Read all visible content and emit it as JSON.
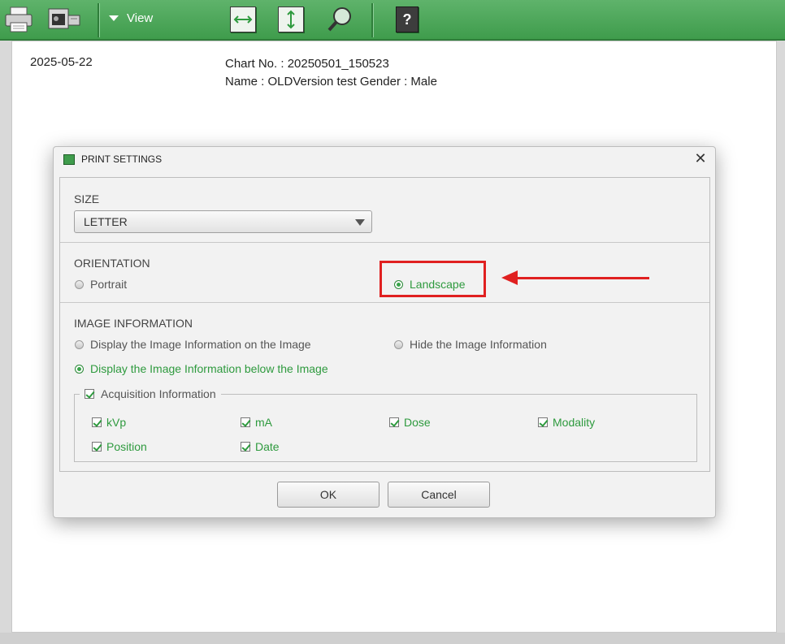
{
  "toolbar": {
    "view_label": "View",
    "icons": [
      "printer-icon",
      "scanner-icon",
      "fit-width-icon",
      "fit-height-icon",
      "zoom-icon",
      "help-icon"
    ],
    "help_glyph": "?",
    "accent": "#3f9c4c"
  },
  "page": {
    "date": "2025-05-22",
    "chart_no": "Chart No. : 20250501_150523",
    "name_line": "Name : OLDVersion test Gender : Male"
  },
  "dialog": {
    "title": "PRINT SETTINGS",
    "close_glyph": "✕",
    "size": {
      "label": "SIZE",
      "selected": "LETTER"
    },
    "orientation": {
      "label": "ORIENTATION",
      "portrait": "Portrait",
      "landscape": "Landscape",
      "selected": "Landscape"
    },
    "image_info": {
      "label": "IMAGE INFORMATION",
      "on_image": "Display the Image Information on the Image",
      "hide": "Hide the Image Information",
      "below_image": "Display the Image Information below the Image",
      "selected": "Display the Image Information below the Image"
    },
    "acquisition": {
      "legend": "Acquisition Information",
      "checked": true,
      "items": [
        {
          "label": "kVp",
          "checked": true
        },
        {
          "label": "mA",
          "checked": true
        },
        {
          "label": "Dose",
          "checked": true
        },
        {
          "label": "Modality",
          "checked": true
        },
        {
          "label": "Position",
          "checked": true
        },
        {
          "label": "Date",
          "checked": true
        }
      ]
    },
    "ok_label": "OK",
    "cancel_label": "Cancel"
  },
  "annotation": {
    "color": "#e02020"
  }
}
